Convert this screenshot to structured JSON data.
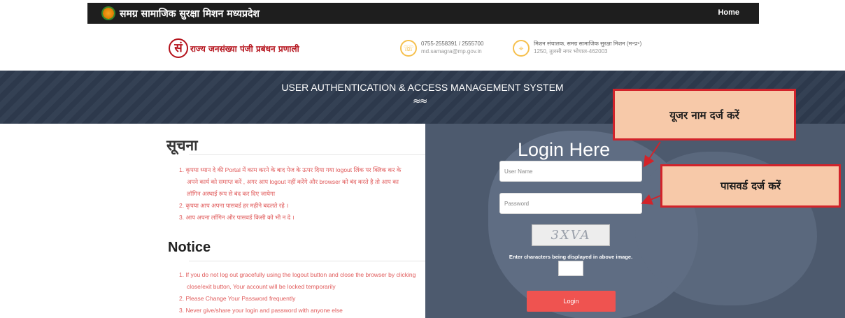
{
  "topbar": {
    "title": "समग्र सामाजिक सुरक्षा मिशन मध्यप्रदेश",
    "home_link": "Home"
  },
  "header": {
    "brand_mark": "सं",
    "brand_text": "राज्य जनसंख्या पंजी प्रबंधन प्रणाली",
    "phone": "0755-2558391 / 2555700",
    "email": "md.samagra@mp.gov.in",
    "address_line1": "मिशन संचालक, समग्र सामाजिक सुरक्षा मिशन (म॰प्र॰)",
    "address_line2": "1250, तुलसी नगर भोपाल-462003",
    "phone_icon": "phone-icon",
    "location_icon": "location-pin-icon"
  },
  "banner": {
    "title": "USER AUTHENTICATION & ACCESS MANAGEMENT SYSTEM",
    "wave": "≈≈"
  },
  "notice_hindi": {
    "heading": "सूचना",
    "item1_a": "1. कृपया ध्यान दे की Portal में काम करने के बाद पेज के ऊपर दिया गया logout लिंक पर क्लिक कर के",
    "item1_b": "अपने कार्य को समाप्त करें , अगर आप logout नहीं करेंगे और browser को बंद करते है तो आप का",
    "item1_c": "लॉगिन अस्थाई रूप से बंद कर दिए जायेगा",
    "item2": "2. कृपया आप अपना पासवर्ड हर महीने बदलते रहे ।",
    "item3": "3. आप अपना लॉगिन और पासवर्ड किसी को भी न दे ।"
  },
  "notice_english": {
    "heading": "Notice",
    "item1_a": "1. If you do not log out gracefully using the logout button and close the browser by clicking",
    "item1_b": "close/exit button, Your account will be locked temporarily",
    "item2": "2. Please Change Your Password frequently",
    "item3": "3. Never give/share your login and password with anyone else"
  },
  "login": {
    "title": "Login Here",
    "username_placeholder": "User Name",
    "password_placeholder": "Password",
    "captcha_text": "3XVA",
    "captcha_hint": "Enter characters being displayed in above image.",
    "login_button": "Login"
  },
  "callouts": {
    "username": "यूजर नाम दर्ज करें",
    "password": "पासवर्ड दर्ज करें",
    "color_border": "#d2232a",
    "color_fill": "#f7c9a9"
  }
}
